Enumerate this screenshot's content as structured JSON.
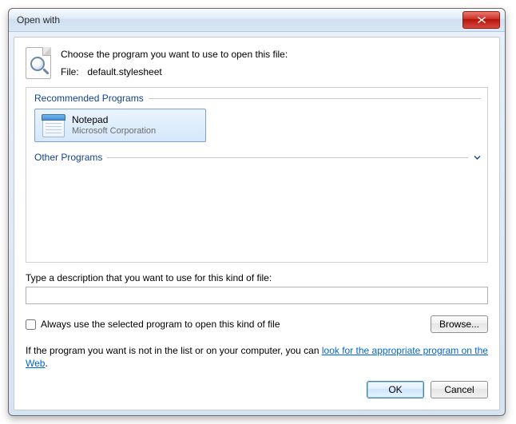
{
  "window": {
    "title": "Open with"
  },
  "intro": {
    "choose": "Choose the program you want to use to open this file:",
    "file_label": "File:",
    "filename": "default.stylesheet"
  },
  "sections": {
    "recommended": "Recommended Programs",
    "other": "Other Programs"
  },
  "programs": {
    "recommended": [
      {
        "name": "Notepad",
        "vendor": "Microsoft Corporation"
      }
    ]
  },
  "description": {
    "label": "Type a description that you want to use for this kind of file:",
    "value": ""
  },
  "always": {
    "label": "Always use the selected program to open this kind of file",
    "checked": false
  },
  "buttons": {
    "browse": "Browse...",
    "ok": "OK",
    "cancel": "Cancel"
  },
  "help": {
    "prefix": "If the program you want is not in the list or on your computer, you can ",
    "link": "look for the appropriate program on the Web",
    "suffix": "."
  }
}
